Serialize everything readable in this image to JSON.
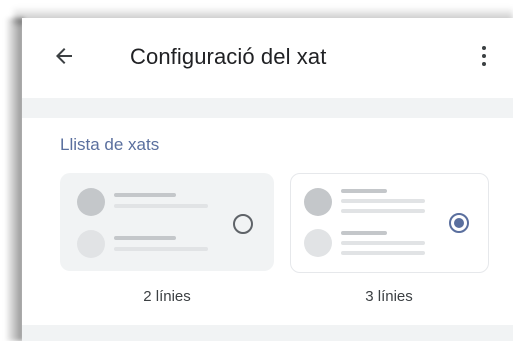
{
  "app_bar": {
    "title": "Configuració del xat",
    "back_icon": "arrow-left-icon",
    "menu_icon": "more-vert-icon"
  },
  "section": {
    "title": "Llista de xats"
  },
  "options": [
    {
      "label": "2 línies",
      "selected": false
    },
    {
      "label": "3 línies",
      "selected": true
    }
  ],
  "colors": {
    "accent": "#5a6f9e",
    "selected_card_bg": "#ffffff",
    "unselected_card_bg": "#f1f3f4",
    "placeholder_dark": "#c4c7ca",
    "placeholder_light": "#e1e3e5"
  }
}
